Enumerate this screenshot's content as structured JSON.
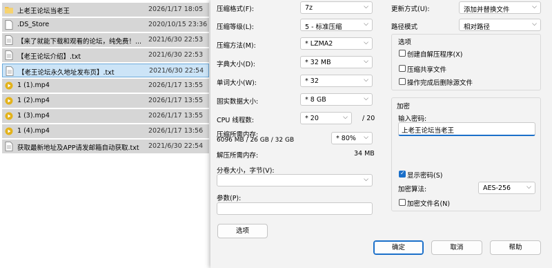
{
  "files": [
    {
      "name": "上老王论坛当老王",
      "date": "2026/1/17 18:05",
      "icon": "folder-icon"
    },
    {
      "name": ".DS_Store",
      "date": "2020/10/15 23:36",
      "icon": "file-icon"
    },
    {
      "name": "【来了就能下载和观看的论坛，纯免费！...",
      "date": "2021/6/30 22:53",
      "icon": "text-file-icon"
    },
    {
      "name": "【老王论坛介绍】.txt",
      "date": "2021/6/30 22:53",
      "icon": "text-file-icon"
    },
    {
      "name": "【老王论坛永久地址发布页】.txt",
      "date": "2021/6/30 22:54",
      "icon": "text-file-icon"
    },
    {
      "name": "1 (1).mp4",
      "date": "2026/1/17 13:55",
      "icon": "video-icon"
    },
    {
      "name": "1 (2).mp4",
      "date": "2026/1/17 13:55",
      "icon": "video-icon"
    },
    {
      "name": "1 (3).mp4",
      "date": "2026/1/17 13:55",
      "icon": "video-icon"
    },
    {
      "name": "1 (4).mp4",
      "date": "2026/1/17 13:56",
      "icon": "video-icon"
    },
    {
      "name": "获取最新地址及APP请发邮箱自动获取.txt",
      "date": "2021/6/30 22:54",
      "icon": "text-file-icon"
    }
  ],
  "dialog": {
    "format": {
      "label": "压缩格式(F):",
      "value": "7z"
    },
    "level": {
      "label": "压缩等级(L):",
      "value": "5 - 标准压缩"
    },
    "method": {
      "label": "压缩方法(M):",
      "value": "* LZMA2"
    },
    "dict": {
      "label": "字典大小(D):",
      "value": "* 32 MB"
    },
    "word": {
      "label": "单词大小(W):",
      "value": "* 32"
    },
    "solid": {
      "label": "固实数据大小:",
      "value": "* 8 GB"
    },
    "cpu": {
      "label": "CPU 线程数:",
      "value": "* 20",
      "max": "/ 20"
    },
    "mem_compress": {
      "label": "压缩所需内存:",
      "detail": "6096 MB / 26 GB / 32 GB",
      "value": "* 80%"
    },
    "mem_decompress": {
      "label": "解压所需内存:",
      "value": "34 MB"
    },
    "split": {
      "label": "分卷大小，字节(V):",
      "value": ""
    },
    "params": {
      "label": "参数(P):",
      "value": ""
    },
    "options_button": "选项",
    "update": {
      "label": "更新方式(U):",
      "value": "添加并替换文件"
    },
    "path": {
      "label": "路径模式",
      "value": "相对路径"
    },
    "options_group": {
      "title": "选项",
      "sfx": "创建自解压程序(X)",
      "shared": "压缩共享文件",
      "delete": "操作完成后删除源文件"
    },
    "encryption": {
      "title": "加密",
      "password_label": "输入密码:",
      "password": "上老王论坛当老王",
      "show_password": "显示密码(S)",
      "method_label": "加密算法:",
      "method": "AES-256",
      "encrypt_names": "加密文件名(N)"
    },
    "ok": "确定",
    "cancel": "取消",
    "help": "帮助"
  },
  "colors": {
    "accent": "#1a6fc9",
    "selected_row": "#cce4f7",
    "row_bg": "#d6d6d6",
    "folder": "#f2c14e",
    "video": "#e3b21a"
  }
}
